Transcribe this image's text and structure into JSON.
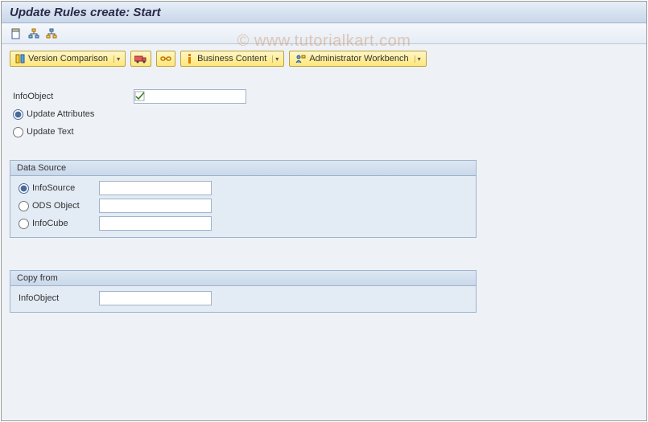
{
  "title": "Update Rules create: Start",
  "watermark": "© www.tutorialkart.com",
  "toolbar": {
    "version_comparison": "Version Comparison",
    "business_content": "Business Content",
    "admin_workbench": "Administrator Workbench"
  },
  "form": {
    "infoobject_label": "InfoObject",
    "infoobject_value": "",
    "update_attributes_label": "Update Attributes",
    "update_text_label": "Update Text",
    "update_selected": "attributes"
  },
  "data_source": {
    "title": "Data Source",
    "infosource_label": "InfoSource",
    "ods_label": "ODS Object",
    "infocube_label": "InfoCube",
    "selected": "infosource",
    "infosource_value": "",
    "ods_value": "",
    "infocube_value": ""
  },
  "copy_from": {
    "title": "Copy from",
    "infoobject_label": "InfoObject",
    "infoobject_value": ""
  }
}
